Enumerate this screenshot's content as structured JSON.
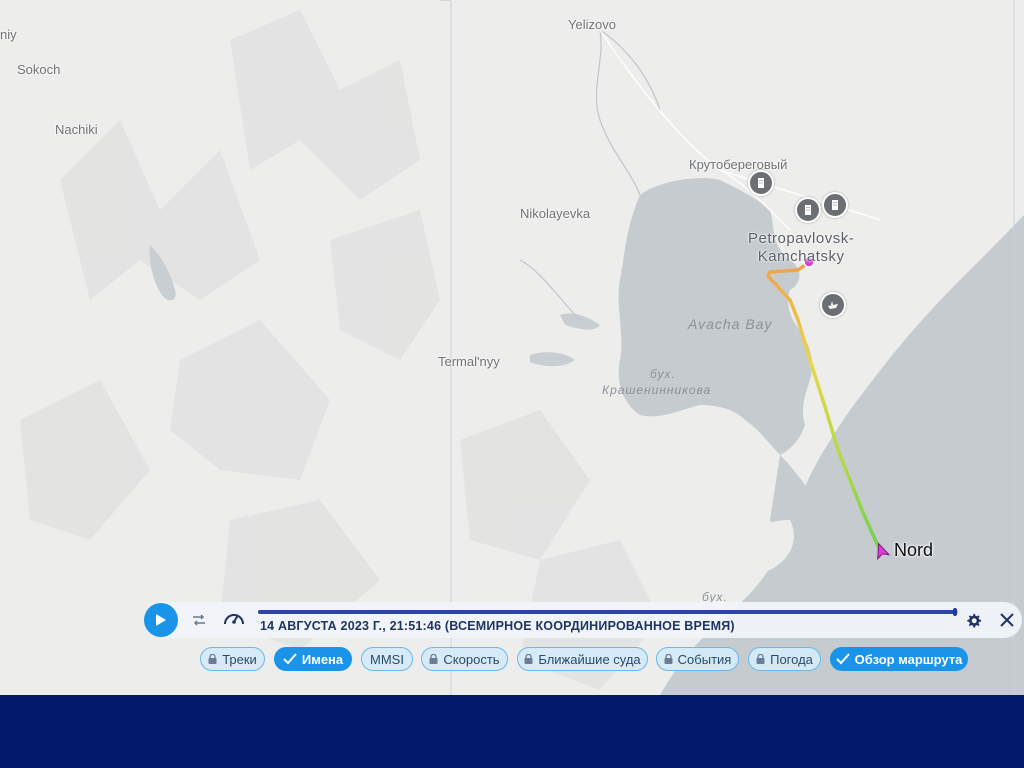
{
  "map": {
    "labels": {
      "top_left": "niy",
      "sokoch": "Sokoch",
      "nachiki": "Nachiki",
      "yelizovo": "Yelizovo",
      "krutoberegovy": "Крутобереговый",
      "nikolayevka": "Nikolayevka",
      "petropavlovsk_1": "Petropavlovsk-",
      "petropavlovsk_2": "Kamchatsky",
      "avacha_bay": "Avacha Bay",
      "termalnyy": "Termal'nyy",
      "bukh_1": "бух.",
      "krasheninnikova": "Крашенинникова",
      "bukh_2": "бух."
    },
    "poi_icons": [
      "building-icon",
      "building-icon",
      "building-icon",
      "ship-wreck-icon"
    ],
    "vessel": {
      "name": "Nord",
      "color": "#e23ad8"
    },
    "track_colors": [
      "#f2a04a",
      "#e8d84a",
      "#a8d84a",
      "#6fd24a"
    ]
  },
  "player": {
    "timestamp": "14 АВГУСТА 2023 Г., 21:51:46 (ВСЕМИРНОЕ КООРДИНИРОВАННОЕ ВРЕМЯ)",
    "progress": 0.995,
    "icons": {
      "play": "play-icon",
      "loop": "loop-icon",
      "speed": "speedometer-icon",
      "settings": "gear-icon",
      "close": "close-icon"
    }
  },
  "filters": [
    {
      "label": "Треки",
      "state": "locked"
    },
    {
      "label": "Имена",
      "state": "active"
    },
    {
      "label": "MMSI",
      "state": "normal"
    },
    {
      "label": "Скорость",
      "state": "locked"
    },
    {
      "label": "Ближайшие суда",
      "state": "locked"
    },
    {
      "label": "События",
      "state": "locked"
    },
    {
      "label": "Погода",
      "state": "locked"
    },
    {
      "label": "Обзор маршрута",
      "state": "active"
    }
  ],
  "colors": {
    "accent": "#1a94e8",
    "footer": "#02196b",
    "sea": "#c5cbcf",
    "land": "#ededec"
  }
}
